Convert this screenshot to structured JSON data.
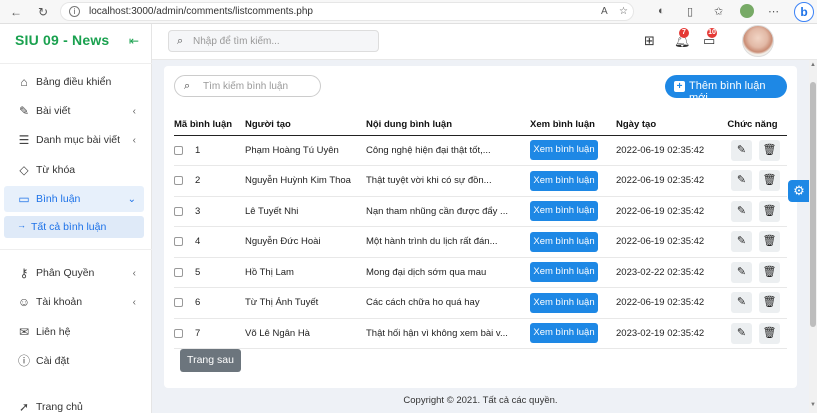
{
  "browser": {
    "url": "localhost:3000/admin/comments/listcomments.php",
    "back": "←",
    "forward": "→",
    "reload": "↻",
    "info": "i"
  },
  "sidebar": {
    "brand": "SIU 09 - News",
    "items": [
      {
        "label": "Bảng điều khiển",
        "icon": "home-icon",
        "glyph": "⌂",
        "chevron": ""
      },
      {
        "label": "Bài viết",
        "icon": "edit-icon",
        "glyph": "✎",
        "chevron": "‹"
      },
      {
        "label": "Danh mục bài viết",
        "icon": "list-icon",
        "glyph": "☰",
        "chevron": "‹"
      },
      {
        "label": "Từ khóa",
        "icon": "tag-icon",
        "glyph": "◇",
        "chevron": ""
      },
      {
        "label": "Bình luận",
        "icon": "comment-icon",
        "glyph": "▭",
        "chevron": "⌄"
      },
      {
        "label": "Phân Quyền",
        "icon": "key-icon",
        "glyph": "⚷",
        "chevron": "‹"
      },
      {
        "label": "Tài khoản",
        "icon": "user-icon",
        "glyph": "☺",
        "chevron": "‹"
      },
      {
        "label": "Liên hệ",
        "icon": "mail-icon",
        "glyph": "✉",
        "chevron": ""
      },
      {
        "label": "Cài đặt",
        "icon": "settings-icon",
        "glyph": "ⓘ",
        "chevron": ""
      },
      {
        "label": "Trang chủ",
        "icon": "pointer-icon",
        "glyph": "➚",
        "chevron": ""
      }
    ],
    "sub_item": "Tất cả bình luận"
  },
  "topbar": {
    "search_placeholder": "Nhập để tìm kiếm...",
    "notifications_count": "7",
    "messages_count": "10"
  },
  "content": {
    "search_placeholder": "Tìm kiếm bình luận",
    "add_button": "Thêm bình luận mới",
    "columns": [
      "Mã bình luận",
      "Người tạo",
      "Nội dung bình luận",
      "Xem bình luận",
      "Ngày tạo",
      "Chức năng"
    ],
    "rows": [
      {
        "id": "1",
        "author": "Phạm Hoàng Tú Uyên",
        "content": "Công nghệ hiện đại thật tốt,...",
        "view": "Xem bình luận",
        "date": "2022-06-19 02:35:42"
      },
      {
        "id": "2",
        "author": "Nguyễn Huỳnh Kim Thoa",
        "content": "Thật tuyệt vời khi có sự đồn...",
        "view": "Xem bình luận",
        "date": "2022-06-19 02:35:42"
      },
      {
        "id": "3",
        "author": "Lê Tuyết Nhi",
        "content": "Nạn tham nhũng cần được đẩy ...",
        "view": "Xem bình luận",
        "date": "2022-06-19 02:35:42"
      },
      {
        "id": "4",
        "author": "Nguyễn Đức Hoài",
        "content": "Một hành trình du lịch rất đán...",
        "view": "Xem bình luận",
        "date": "2022-06-19 02:35:42"
      },
      {
        "id": "5",
        "author": "Hồ Thị Lam",
        "content": "Mong đại dịch sớm qua mau",
        "view": "Xem bình luận",
        "date": "2023-02-22 02:35:42"
      },
      {
        "id": "6",
        "author": "Từ Thị Ánh Tuyết",
        "content": "Các cách chữa ho quá hay",
        "view": "Xem bình luận",
        "date": "2022-06-19 02:35:42"
      },
      {
        "id": "7",
        "author": "Võ Lê Ngân Hà",
        "content": "Thật hối hận vì không xem bài v...",
        "view": "Xem bình luận",
        "date": "2023-02-19 02:35:42"
      }
    ],
    "next_button": "Trang sau"
  },
  "footer": "Copyright © 2021. Tất cả các quyền."
}
